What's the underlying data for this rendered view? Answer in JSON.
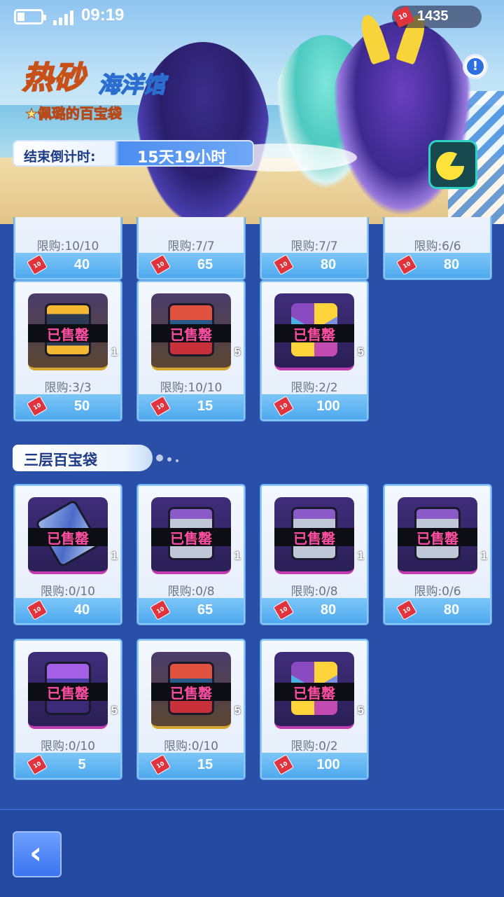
{
  "status": {
    "time": "09:19"
  },
  "currency": {
    "amount": "1435",
    "icon": "ticket-icon",
    "icon_label": "10"
  },
  "banner": {
    "title": "热砂",
    "subtitle": "海洋馆",
    "tagline": "★佩璐的百宝袋",
    "countdown_label": "结束倒计时:",
    "countdown_value": "15天19小时"
  },
  "sold_label": "已售罄",
  "sections": [
    {
      "title": "",
      "items": [
        {
          "limit": "限购:10/10",
          "price": "40"
        },
        {
          "limit": "限购:7/7",
          "price": "65"
        },
        {
          "limit": "限购:7/7",
          "price": "80"
        },
        {
          "limit": "限购:6/6",
          "price": "80"
        },
        {
          "limit": "限购:3/3",
          "price": "50",
          "qty": "1",
          "icon": "gold-chest-icon"
        },
        {
          "limit": "限购:10/10",
          "price": "15",
          "qty": "5",
          "icon": "red-chest-icon"
        },
        {
          "limit": "限购:2/2",
          "price": "100",
          "qty": "5",
          "icon": "gem-icon"
        }
      ]
    },
    {
      "title": "三层百宝袋",
      "items": [
        {
          "limit": "限购:0/10",
          "price": "40",
          "qty": "1",
          "icon": "potion-icon"
        },
        {
          "limit": "限购:0/8",
          "price": "65",
          "qty": "1",
          "icon": "console-icon"
        },
        {
          "limit": "限购:0/8",
          "price": "80",
          "qty": "1",
          "icon": "console-icon"
        },
        {
          "limit": "限购:0/6",
          "price": "80",
          "qty": "1",
          "icon": "console-icon"
        },
        {
          "limit": "限购:0/10",
          "price": "5",
          "qty": "5",
          "icon": "purple-chest-icon"
        },
        {
          "limit": "限购:0/10",
          "price": "15",
          "qty": "5",
          "icon": "red-chest-icon"
        },
        {
          "limit": "限购:0/2",
          "price": "100",
          "qty": "5",
          "icon": "gem-icon"
        }
      ]
    }
  ],
  "nav": {
    "back_icon": "chevron-left-icon",
    "back_glyph": "‹"
  },
  "colors": {
    "background": "#2a4fa8",
    "sold": "#ff4fa0",
    "price_bar": "#4ea9ee"
  }
}
